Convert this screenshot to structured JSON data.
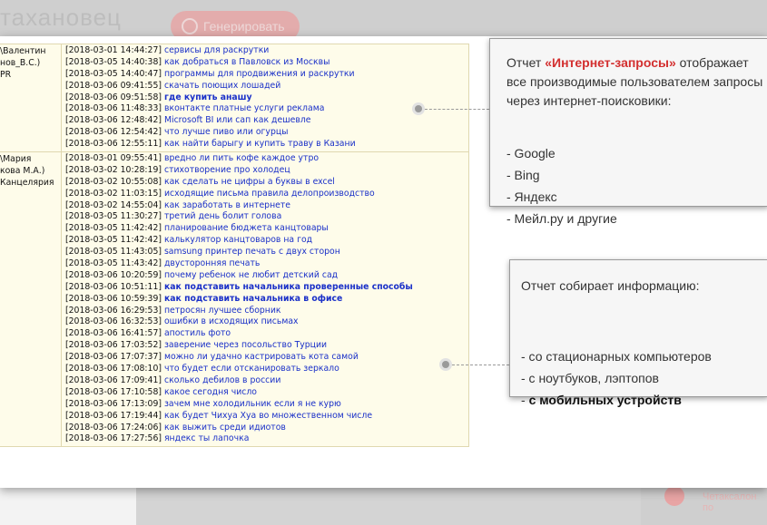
{
  "background": {
    "brand": "тахановец",
    "button_label": "Генерировать",
    "bottom_right_label": "Четаксалон по"
  },
  "log_groups": [
    {
      "user_lines": [
        "\\Валентин",
        "нов_В.С.)",
        "PR"
      ],
      "rows": [
        {
          "ts": "[2018-03-01 14:44:27]",
          "q": "сервисы для раскрутки",
          "bold": false
        },
        {
          "ts": "[2018-03-05 14:40:38]",
          "q": "как добраться в Павловск из Москвы",
          "bold": false
        },
        {
          "ts": "[2018-03-05 14:40:47]",
          "q": "программы для продвижения и раскрутки",
          "bold": false
        },
        {
          "ts": "[2018-03-06 09:41:55]",
          "q": "скачать поющих лошадей",
          "bold": false
        },
        {
          "ts": "[2018-03-06 09:51:58]",
          "q": "где купить анашу",
          "bold": true
        },
        {
          "ts": "[2018-03-06 11:48:33]",
          "q": "вконтакте платные услуги реклама",
          "bold": false
        },
        {
          "ts": "[2018-03-06 12:48:42]",
          "q": "Microsoft BI или сап как дешевле",
          "bold": false
        },
        {
          "ts": "[2018-03-06 12:54:42]",
          "q": "что лучше пиво или огурцы",
          "bold": false
        },
        {
          "ts": "[2018-03-06 12:55:11]",
          "q": "как найти барыгу и купить траву в Казани",
          "bold": false
        }
      ]
    },
    {
      "user_lines": [
        "\\Мария",
        "кова М.А.)",
        "Канцелярия"
      ],
      "rows": [
        {
          "ts": "[2018-03-01 09:55:41]",
          "q": "вредно ли пить кофе каждое утро",
          "bold": false
        },
        {
          "ts": "[2018-03-02 10:28:19]",
          "q": "стихотворение про холодец",
          "bold": false
        },
        {
          "ts": "[2018-03-02 10:55:08]",
          "q": "как сделать не цифры а буквы в excel",
          "bold": false
        },
        {
          "ts": "[2018-03-02 11:03:15]",
          "q": "исходящие письма правила делопроизводство",
          "bold": false
        },
        {
          "ts": "[2018-03-02 14:55:04]",
          "q": "как заработать в интернете",
          "bold": false
        },
        {
          "ts": "[2018-03-05 11:30:27]",
          "q": "третий день болит голова",
          "bold": false
        },
        {
          "ts": "[2018-03-05 11:42:42]",
          "q": "планирование бюджета канцтовары",
          "bold": false
        },
        {
          "ts": "[2018-03-05 11:42:42]",
          "q": "калькулятор канцтоваров на год",
          "bold": false
        },
        {
          "ts": "[2018-03-05 11:43:05]",
          "q": "samsung принтер печать с двух сторон",
          "bold": false
        },
        {
          "ts": "[2018-03-05 11:43:42]",
          "q": "двусторонняя печать",
          "bold": false
        },
        {
          "ts": "[2018-03-06 10:20:59]",
          "q": "почему ребенок не любит детский сад",
          "bold": false
        },
        {
          "ts": "[2018-03-06 10:51:11]",
          "q": "как подставить начальника проверенные способы",
          "bold": true
        },
        {
          "ts": "[2018-03-06 10:59:39]",
          "q": "как подставить начальника в офисе",
          "bold": true
        },
        {
          "ts": "[2018-03-06 16:29:53]",
          "q": "петросян лучшее сборник",
          "bold": false
        },
        {
          "ts": "[2018-03-06 16:32:53]",
          "q": "ошибки в исходящих письмах",
          "bold": false
        },
        {
          "ts": "[2018-03-06 16:41:57]",
          "q": "апостиль фото",
          "bold": false
        },
        {
          "ts": "[2018-03-06 17:03:52]",
          "q": "заверение через посольство Турции",
          "bold": false
        },
        {
          "ts": "[2018-03-06 17:07:37]",
          "q": "можно ли удачно кастрировать кота самой",
          "bold": false
        },
        {
          "ts": "[2018-03-06 17:08:10]",
          "q": "что будет если отсканировать зеркало",
          "bold": false
        },
        {
          "ts": "[2018-03-06 17:09:41]",
          "q": "сколько дебилов в россии",
          "bold": false
        },
        {
          "ts": "[2018-03-06 17:10:58]",
          "q": "какое сегодня число",
          "bold": false
        },
        {
          "ts": "[2018-03-06 17:13:09]",
          "q": "зачем мне холодильник если я не курю",
          "bold": false
        },
        {
          "ts": "[2018-03-06 17:19:44]",
          "q": "как будет Чихуа Хуа во множественном числе",
          "bold": false
        },
        {
          "ts": "[2018-03-06 17:24:06]",
          "q": "как выжить среди идиотов",
          "bold": false
        },
        {
          "ts": "[2018-03-06 17:27:56]",
          "q": "яндекс ты лапочка",
          "bold": false
        }
      ]
    }
  ],
  "callout1": {
    "pre": "Отчет ",
    "accent": "«Интернет-запросы»",
    "post": " отображает все производимые пользователем запросы через интернет-поисковики:",
    "items": [
      "- Google",
      "- Bing",
      "- Яндекс",
      "- Мейл.ру и другие"
    ]
  },
  "callout2": {
    "intro": "Отчет собирает информацию:",
    "items": [
      "- со стационарных компьютеров",
      "- с ноутбуков, лэптопов"
    ],
    "last_prefix": "- ",
    "last_bold": "с мобильных устройств"
  },
  "colors": {
    "accent": "#d32f2f",
    "link": "#1a30c8",
    "row_bg": "#fefcea"
  }
}
